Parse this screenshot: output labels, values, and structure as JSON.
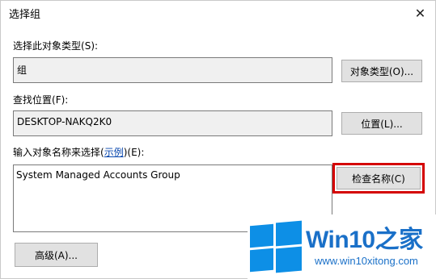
{
  "window": {
    "title": "选择组",
    "close_glyph": "✕"
  },
  "object_type": {
    "label": "选择此对象类型",
    "hotkey": "(S):",
    "value": "组",
    "button_label": "对象类型(O)..."
  },
  "location": {
    "label": "查找位置",
    "hotkey": "(F):",
    "value": "DESKTOP-NAKQ2K0",
    "button_label": "位置(L)..."
  },
  "names": {
    "label_prefix": "输入对象名称来选择(",
    "examples_link": "示例",
    "label_suffix": ")(E):",
    "value": "System Managed Accounts Group",
    "check_button_label": "检查名称(C)"
  },
  "advanced": {
    "button_label": "高级(A)..."
  },
  "watermark": {
    "brand": "Win10",
    "brand_suffix": "之家",
    "url": "www.win10xitong.com",
    "logo_color": "#0d8fe6"
  },
  "colors": {
    "highlight": "#d40000"
  },
  "icons": {
    "close": "close-icon",
    "windows_logo": "windows-logo-icon"
  }
}
